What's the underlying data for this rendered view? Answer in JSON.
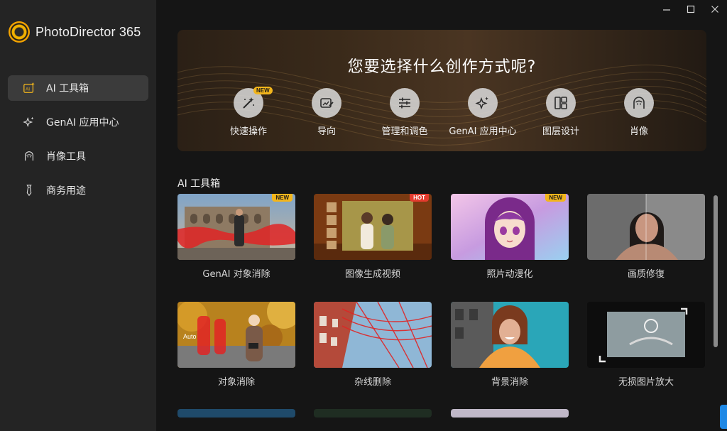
{
  "app": {
    "title": "PhotoDirector 365"
  },
  "window": {
    "minimize_icon": "minimize-icon",
    "maximize_icon": "maximize-icon",
    "close_icon": "close-icon"
  },
  "sidebar": {
    "items": [
      {
        "label": "AI 工具箱",
        "icon": "ai-toolbox-icon",
        "active": true
      },
      {
        "label": "GenAI 应用中心",
        "icon": "sparkle-icon",
        "active": false
      },
      {
        "label": "肖像工具",
        "icon": "portrait-icon",
        "active": false
      },
      {
        "label": "商务用途",
        "icon": "tie-icon",
        "active": false
      }
    ]
  },
  "hero": {
    "title": "您要选择什么创作方式呢?",
    "modes": [
      {
        "label": "快速操作",
        "icon": "magic-wand-icon",
        "badge": "NEW"
      },
      {
        "label": "导向",
        "icon": "guided-edit-icon"
      },
      {
        "label": "管理和调色",
        "icon": "sliders-icon"
      },
      {
        "label": "GenAI 应用中心",
        "icon": "sparkle-icon"
      },
      {
        "label": "图层设计",
        "icon": "layers-icon"
      },
      {
        "label": "肖像",
        "icon": "portrait-icon"
      }
    ]
  },
  "section": {
    "title": "AI 工具箱"
  },
  "cards": [
    {
      "label": "GenAI 对象消除",
      "badge": "NEW"
    },
    {
      "label": "图像生成视频",
      "badge": "HOT"
    },
    {
      "label": "照片动漫化",
      "badge": "NEW"
    },
    {
      "label": "画质修復"
    },
    {
      "label": "对象消除",
      "overlay": "Auto"
    },
    {
      "label": "杂线删除"
    },
    {
      "label": "背景消除"
    },
    {
      "label": "无损图片放大"
    }
  ],
  "colors": {
    "accent": "#f2b51c",
    "hot": "#e33b2e",
    "sidebar_bg": "#242424",
    "main_bg": "#151515"
  }
}
